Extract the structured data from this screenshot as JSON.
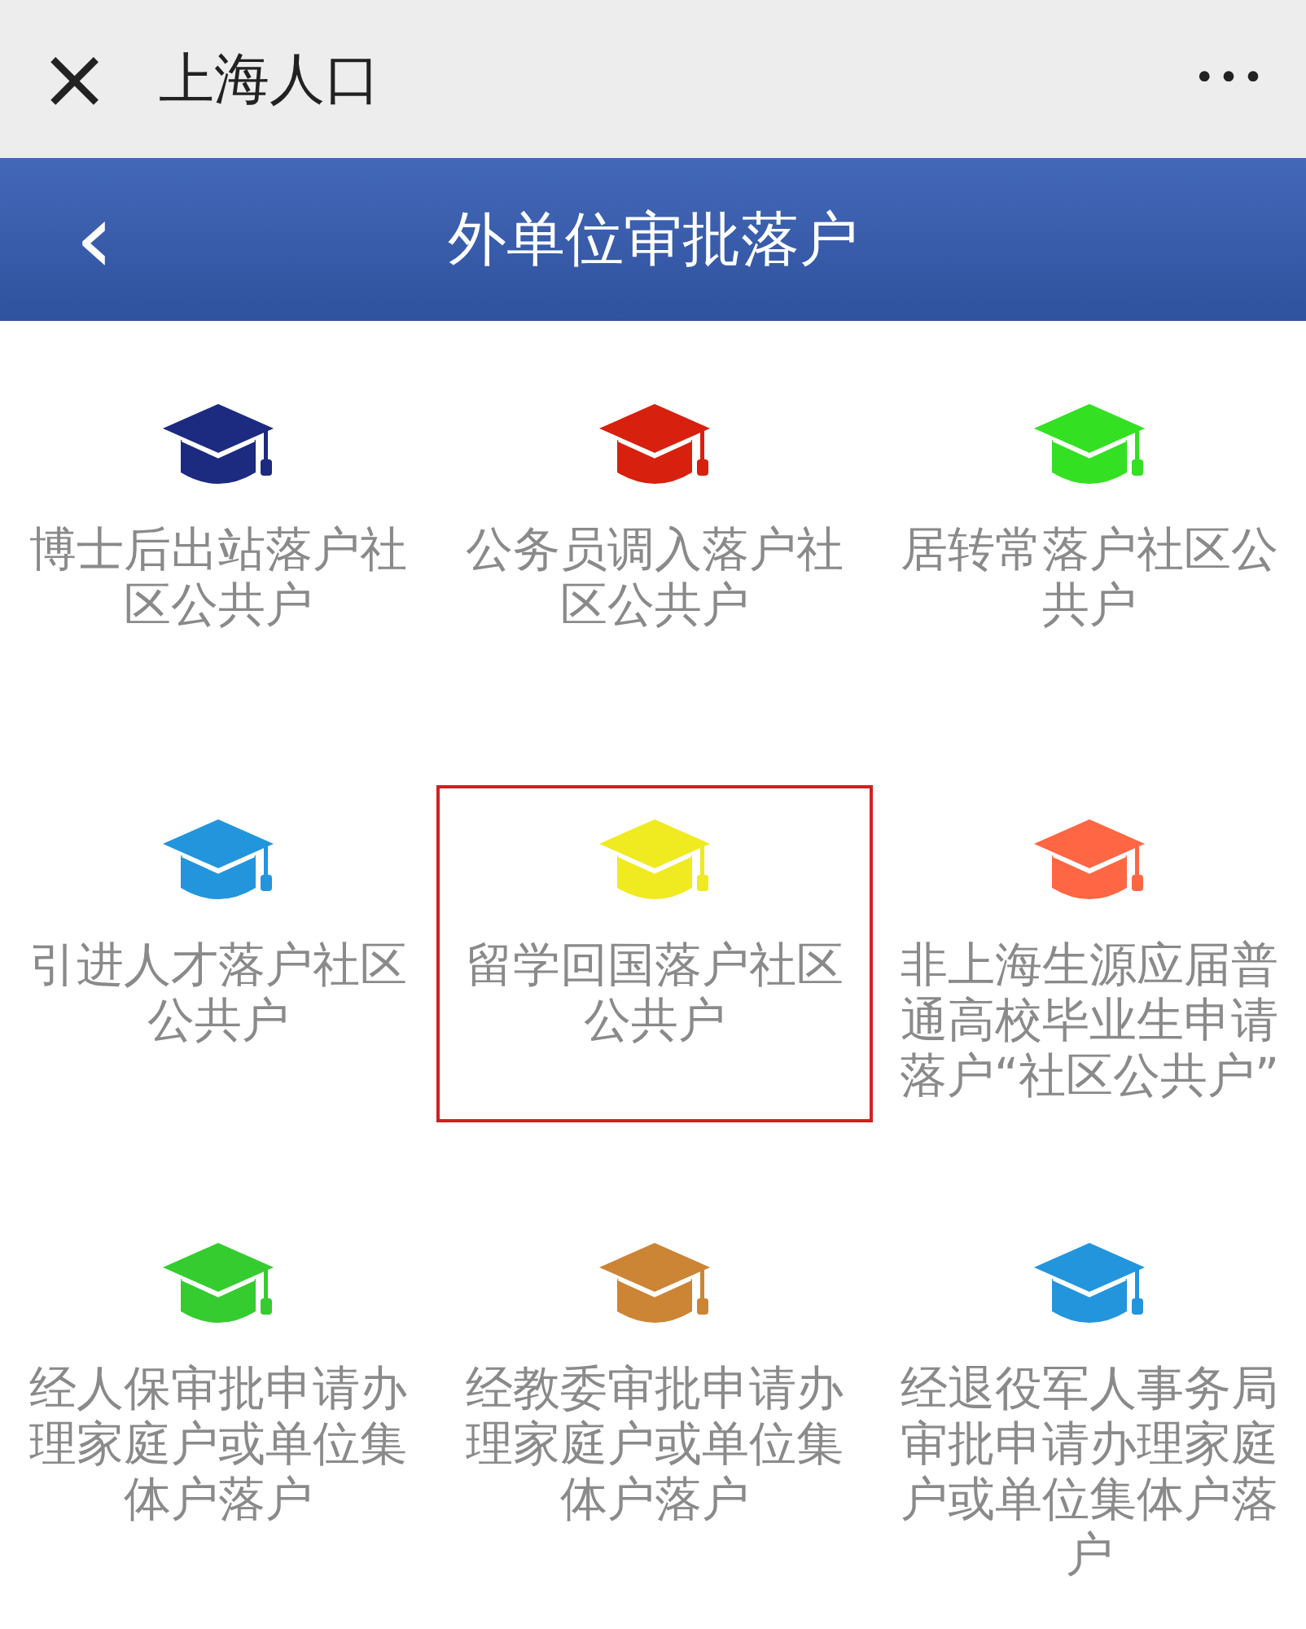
{
  "top_bar": {
    "close": "×",
    "title": "上海人口",
    "more": "•••"
  },
  "header": {
    "back": "‹",
    "title": "外单位审批落户"
  },
  "items": [
    {
      "label": "博士后出站落户社区公共户",
      "color": "#1c2a80",
      "selected": false
    },
    {
      "label": "公务员调入落户社区公共户",
      "color": "#d8200e",
      "selected": false
    },
    {
      "label": "居转常落户社区公共户",
      "color": "#33e022",
      "selected": false
    },
    {
      "label": "引进人才落户社区公共户",
      "color": "#2295dd",
      "selected": false
    },
    {
      "label": "留学回国落户社区公共户",
      "color": "#f0ea20",
      "selected": true
    },
    {
      "label": "非上海生源应届普通高校毕业生申请落户“社区公共户”",
      "color": "#ff6644",
      "selected": false
    },
    {
      "label": "经人保审批申请办理家庭户或单位集体户落户",
      "color": "#35cc30",
      "selected": false
    },
    {
      "label": "经教委审批申请办理家庭户或单位集体户落户",
      "color": "#cc8435",
      "selected": false
    },
    {
      "label": "经退役军人事务局审批申请办理家庭户或单位集体户落户",
      "color": "#2295dd",
      "selected": false
    }
  ]
}
